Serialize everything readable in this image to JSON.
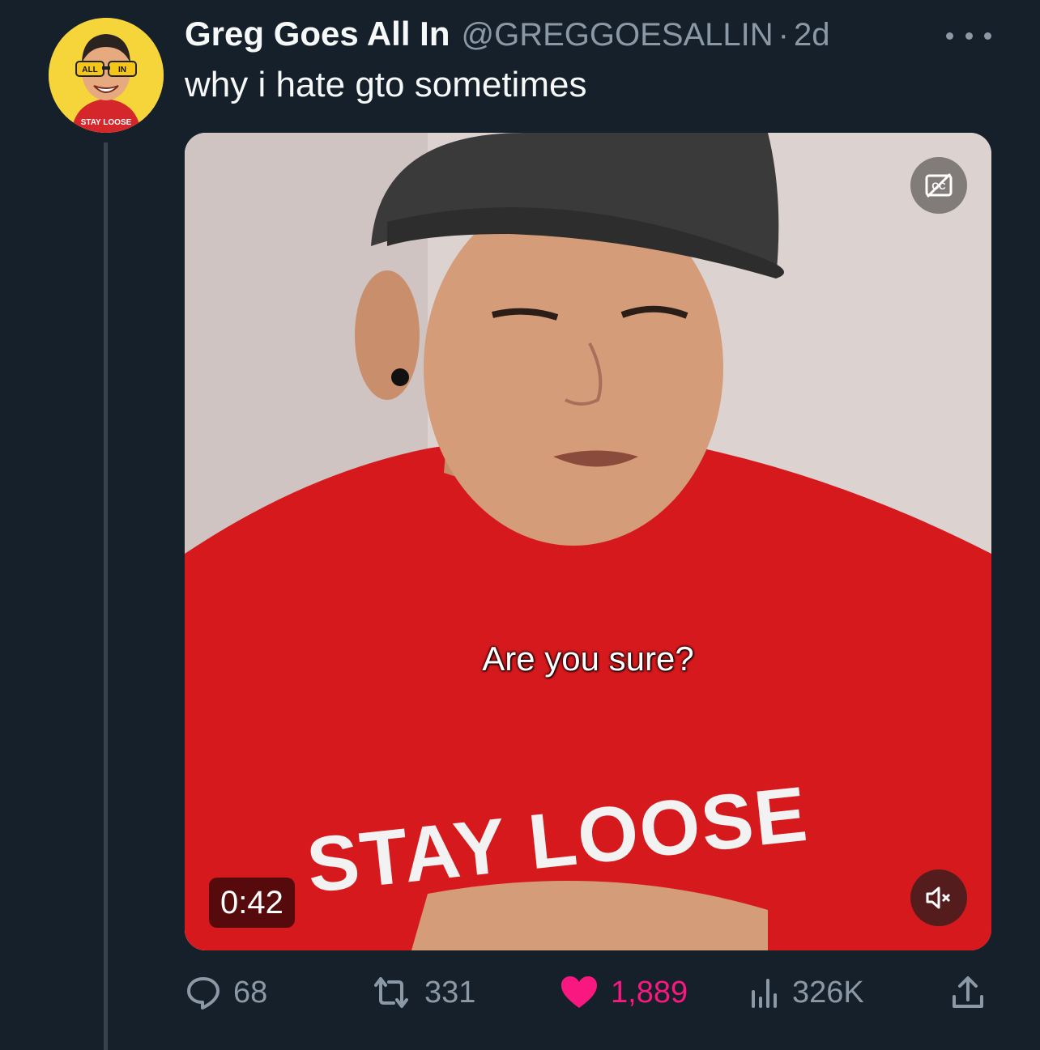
{
  "tweet": {
    "display_name": "Greg Goes All In",
    "handle": "@GREGGOESALLIN",
    "separator": "·",
    "time": "2d",
    "text": "why i hate gto sometimes",
    "avatar": {
      "icon": "avatar-cartoon",
      "glasses_text_left": "ALL",
      "glasses_text_right": "IN",
      "shirt_text": "STAY LOOSE"
    }
  },
  "media": {
    "caption": "Are you sure?",
    "duration": "0:42",
    "shirt_print": "STAY LOOSE",
    "cc_icon": "captions-off-icon",
    "mute_icon": "muted-speaker-icon"
  },
  "actions": {
    "replies": "68",
    "retweets": "331",
    "likes": "1,889",
    "views": "326K"
  },
  "colors": {
    "background": "#15202b",
    "text_primary": "#f7f9f9",
    "text_secondary": "#8b98a5",
    "like_pink": "#f91880",
    "thread_line": "#38444d"
  }
}
